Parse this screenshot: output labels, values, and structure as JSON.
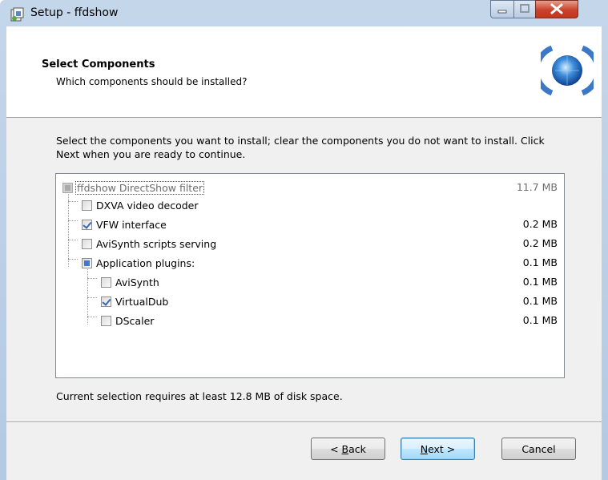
{
  "window": {
    "title": "Setup - ffdshow"
  },
  "header": {
    "title": "Select Components",
    "subtitle": "Which components should be installed?"
  },
  "description": "Select the components you want to install; clear the components you do not want to install. Click Next when you are ready to continue.",
  "components": [
    {
      "label": "ffdshow DirectShow filter",
      "size": "11.7 MB",
      "state": "disabled-checked",
      "level": 0
    },
    {
      "label": "DXVA video decoder",
      "size": "",
      "state": "unchecked",
      "level": 1
    },
    {
      "label": "VFW interface",
      "size": "0.2 MB",
      "state": "checked",
      "level": 1
    },
    {
      "label": "AviSynth scripts serving",
      "size": "0.2 MB",
      "state": "unchecked",
      "level": 1
    },
    {
      "label": "Application plugins:",
      "size": "0.1 MB",
      "state": "partial",
      "level": 1
    },
    {
      "label": "AviSynth",
      "size": "0.1 MB",
      "state": "unchecked",
      "level": 2
    },
    {
      "label": "VirtualDub",
      "size": "0.1 MB",
      "state": "checked",
      "level": 2
    },
    {
      "label": "DScaler",
      "size": "0.1 MB",
      "state": "unchecked",
      "level": 2
    }
  ],
  "status": "Current selection requires at least 12.8 MB of disk space.",
  "buttons": {
    "back_prefix": "< ",
    "back_hotkey": "B",
    "back_rest": "ack",
    "next_hotkey": "N",
    "next_rest": "ext >",
    "cancel": "Cancel"
  },
  "colors": {
    "window_frame": "#b3c9e4",
    "close_button": "#c9412b",
    "check_mark": "#3a64b4",
    "partial_fill": "#3e7bc8"
  }
}
